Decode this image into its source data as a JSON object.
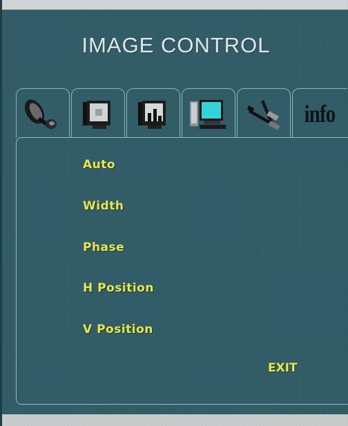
{
  "title": "IMAGE CONTROL",
  "tabs": [
    {
      "icon": "satellite-dish-icon"
    },
    {
      "icon": "monitor-screen-icon"
    },
    {
      "icon": "monitor-equalizer-icon"
    },
    {
      "icon": "computer-display-icon"
    },
    {
      "icon": "tools-icon"
    },
    {
      "icon": "info-icon",
      "label": "info"
    }
  ],
  "menu": {
    "items": [
      "Auto",
      "Width",
      "Phase",
      "H Position",
      "V Position"
    ],
    "exit": "EXIT"
  },
  "colors": {
    "background": "#2e5b66",
    "menu_text": "#e6e84a",
    "title_text": "#dfe8ea",
    "selected_tab_screen": "#33d3d8"
  }
}
